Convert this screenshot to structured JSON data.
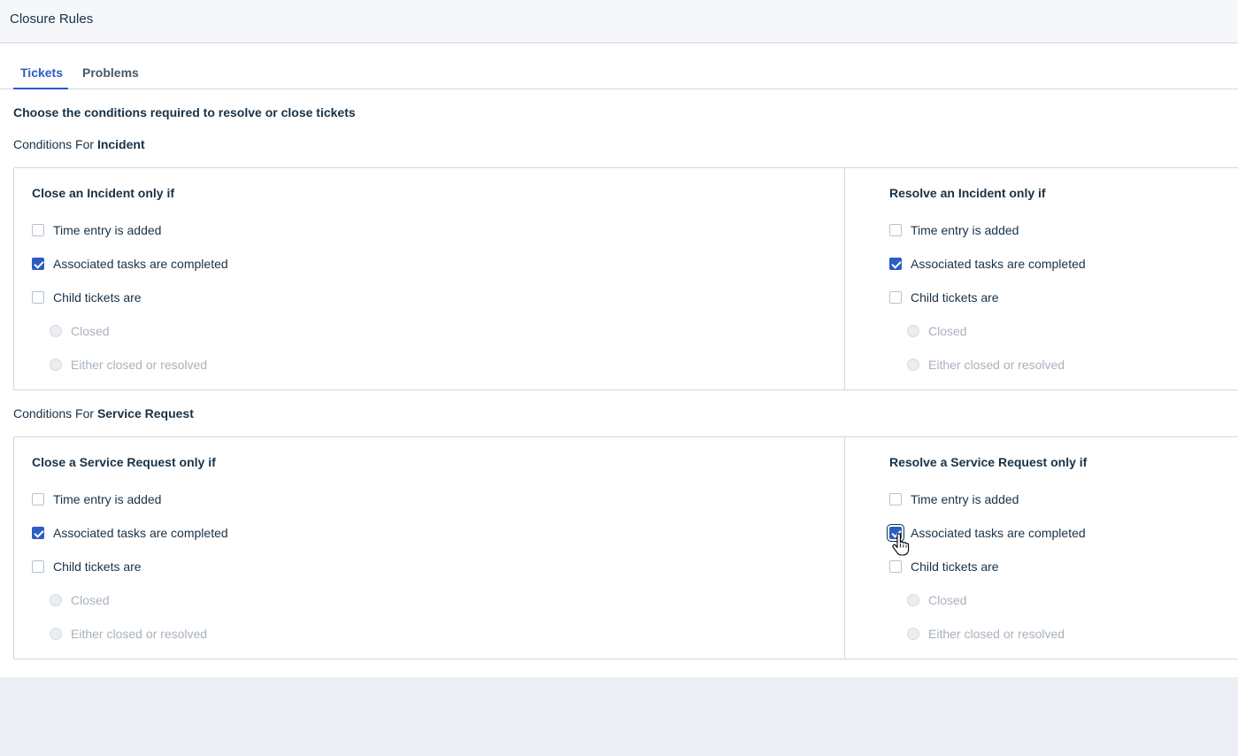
{
  "header": {
    "title": "Closure Rules"
  },
  "tabs": [
    {
      "label": "Tickets",
      "active": true
    },
    {
      "label": "Problems",
      "active": false
    }
  ],
  "intro": "Choose the conditions required to resolve or close tickets",
  "sections": [
    {
      "prefix": "Conditions For",
      "type": "Incident",
      "close": {
        "title": "Close an Incident only if",
        "time_entry": {
          "label": "Time entry is added",
          "checked": false
        },
        "tasks": {
          "label": "Associated tasks are completed",
          "checked": true
        },
        "child": {
          "label": "Child tickets are",
          "checked": false
        },
        "options": [
          "Closed",
          "Either closed or resolved"
        ]
      },
      "resolve": {
        "title": "Resolve an Incident only if",
        "time_entry": {
          "label": "Time entry is added",
          "checked": false
        },
        "tasks": {
          "label": "Associated tasks are completed",
          "checked": true
        },
        "child": {
          "label": "Child tickets are",
          "checked": false
        },
        "options": [
          "Closed",
          "Either closed or resolved"
        ]
      }
    },
    {
      "prefix": "Conditions For",
      "type": "Service Request",
      "close": {
        "title": "Close a Service Request only if",
        "time_entry": {
          "label": "Time entry is added",
          "checked": false
        },
        "tasks": {
          "label": "Associated tasks are completed",
          "checked": true
        },
        "child": {
          "label": "Child tickets are",
          "checked": false
        },
        "options": [
          "Closed",
          "Either closed or resolved"
        ]
      },
      "resolve": {
        "title": "Resolve a Service Request only if",
        "time_entry": {
          "label": "Time entry is added",
          "checked": false
        },
        "tasks": {
          "label": "Associated tasks are completed",
          "checked": true
        },
        "child": {
          "label": "Child tickets are",
          "checked": false
        },
        "options": [
          "Closed",
          "Either closed or resolved"
        ]
      }
    }
  ],
  "colors": {
    "accent": "#2c5cc5",
    "text": "#183247",
    "border": "#cfd7df",
    "disabled_text": "#a8b2bc"
  },
  "icons": {
    "cursor": "hand-pointer-icon",
    "check": "checkmark-icon"
  }
}
